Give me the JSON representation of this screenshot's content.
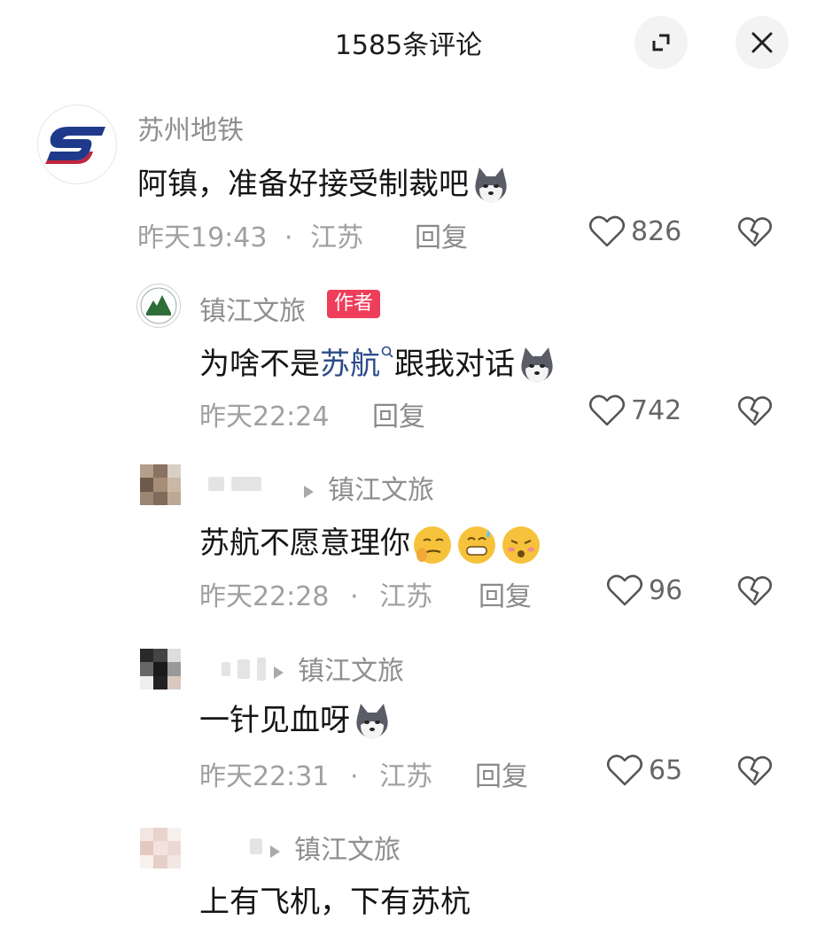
{
  "header": {
    "title": "1585条评论"
  },
  "comments": [
    {
      "user": "苏州地铁",
      "text": "阿镇，准备好接受制裁吧",
      "time": "昨天19:43",
      "location": "江苏",
      "reply_label": "回复",
      "likes": "826"
    },
    {
      "user": "镇江文旅",
      "badge": "作者",
      "text_before": "为啥不是",
      "text_link": "苏航",
      "text_after": "跟我对话",
      "time": "昨天22:24",
      "reply_label": "回复",
      "likes": "742"
    },
    {
      "reply_to": "镇江文旅",
      "text": "苏航不愿意理你",
      "time": "昨天22:28",
      "location": "江苏",
      "reply_label": "回复",
      "likes": "96"
    },
    {
      "reply_to": "镇江文旅",
      "text": "一针见血呀",
      "time": "昨天22:31",
      "location": "江苏",
      "reply_label": "回复",
      "likes": "65"
    },
    {
      "reply_to": "镇江文旅",
      "text": "上有飞机，下有苏杭"
    }
  ],
  "separator": "·",
  "icons": {
    "expand": "expand-icon",
    "close": "close-icon",
    "like": "heart-outline-icon",
    "dislike": "broken-heart-icon",
    "search": "search-icon",
    "reply_arrow": "triangle-right-icon"
  },
  "colors": {
    "badge": "#ef3d5c",
    "link": "#2d4b8a"
  }
}
